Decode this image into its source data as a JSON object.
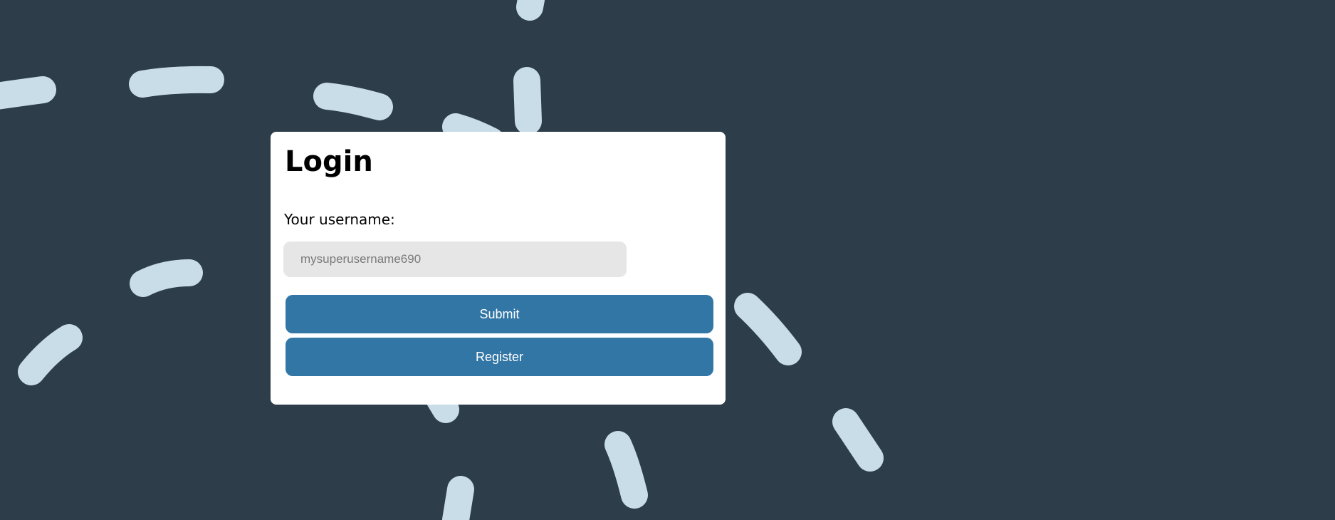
{
  "page": {
    "background_color": "#2d3e4a",
    "dash_color": "#c8dde7"
  },
  "login_card": {
    "title": "Login",
    "username_label": "Your username:",
    "username_placeholder": "mysuperusername690",
    "username_value": "",
    "submit_label": "Submit",
    "register_label": "Register",
    "button_color": "#3276a6"
  }
}
